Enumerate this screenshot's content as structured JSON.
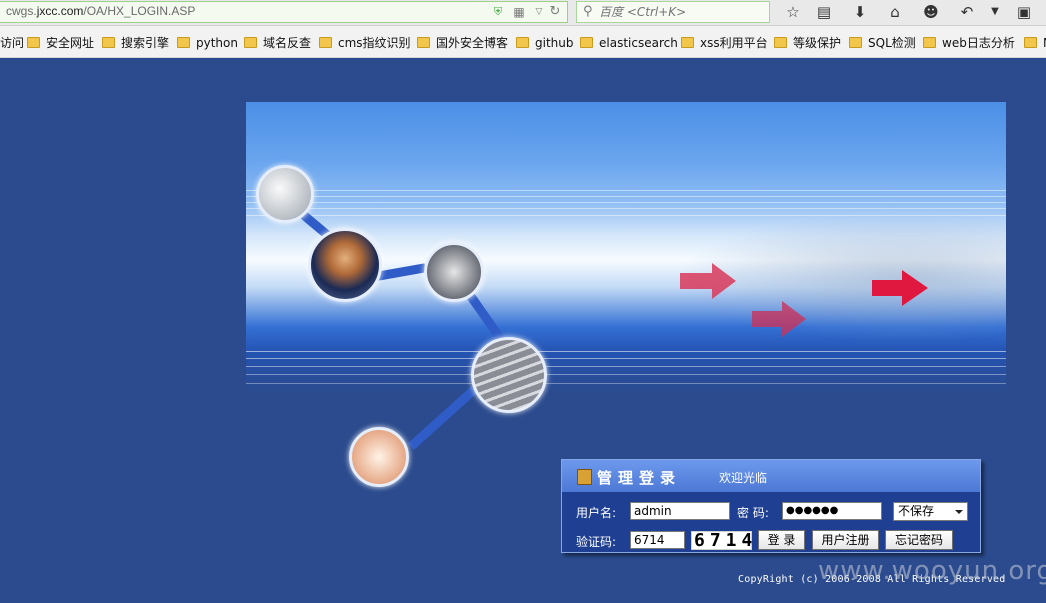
{
  "browser": {
    "url_prefix": "cwgs.",
    "url_domain": "jxcc.com",
    "url_path": "/OA/HX_LOGIN.ASP",
    "search_placeholder": "百度 <Ctrl+K>"
  },
  "bookmarks": [
    {
      "label": "访问",
      "folder": false
    },
    {
      "label": "安全网址",
      "folder": true
    },
    {
      "label": "搜索引擎",
      "folder": true
    },
    {
      "label": "python",
      "folder": true
    },
    {
      "label": "域名反查",
      "folder": true
    },
    {
      "label": "cms指纹识别",
      "folder": true
    },
    {
      "label": "国外安全博客",
      "folder": true
    },
    {
      "label": "github",
      "folder": true
    },
    {
      "label": "elasticsearch",
      "folder": true
    },
    {
      "label": "xss利用平台",
      "folder": true
    },
    {
      "label": "等级保护",
      "folder": true
    },
    {
      "label": "SQL检测",
      "folder": true
    },
    {
      "label": "web日志分析",
      "folder": true
    },
    {
      "label": "N",
      "folder": true
    }
  ],
  "login": {
    "title": "管理登录",
    "welcome": "欢迎光临",
    "username_label": "用户名:",
    "username_value": "admin",
    "password_label": "密 码:",
    "password_value": "●●●●●●",
    "save_option": "不保存",
    "captcha_label": "验证码:",
    "captcha_input": "6714",
    "captcha_image_text": "6714",
    "login_button": "登 录",
    "register_button": "用户注册",
    "forgot_button": "忘记密码"
  },
  "footer": {
    "copyright": "CopyRight (c) 2006-2008 All Rights Reserved",
    "watermark": "www.wooyun.org"
  },
  "colors": {
    "page_bg": "#2b4b8e",
    "accent_arrow": "#d9385a"
  }
}
